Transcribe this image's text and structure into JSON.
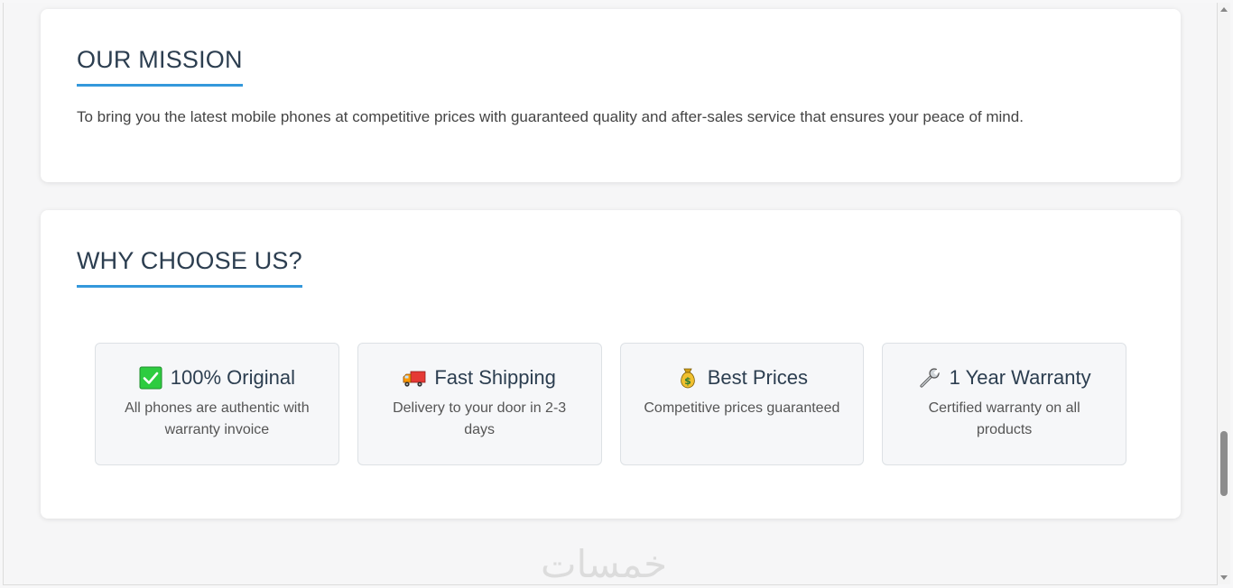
{
  "mission": {
    "title": "OUR MISSION",
    "text": "To bring you the latest mobile phones at competitive prices with guaranteed quality and after-sales service that ensures your peace of mind."
  },
  "why": {
    "title": "WHY CHOOSE US?",
    "features": [
      {
        "icon": "check-mark-icon",
        "title": "100% Original",
        "desc": "All phones are authentic with warranty invoice"
      },
      {
        "icon": "delivery-truck-icon",
        "title": "Fast Shipping",
        "desc": "Delivery to your door in 2-3 days"
      },
      {
        "icon": "money-bag-icon",
        "title": "Best Prices",
        "desc": "Competitive prices guaranteed"
      },
      {
        "icon": "wrench-icon",
        "title": "1 Year Warranty",
        "desc": "Certified warranty on all products"
      }
    ]
  },
  "watermark": "خمسات",
  "colors": {
    "accent": "#3498db",
    "heading": "#2c3e50",
    "check": "#2ecc40"
  }
}
